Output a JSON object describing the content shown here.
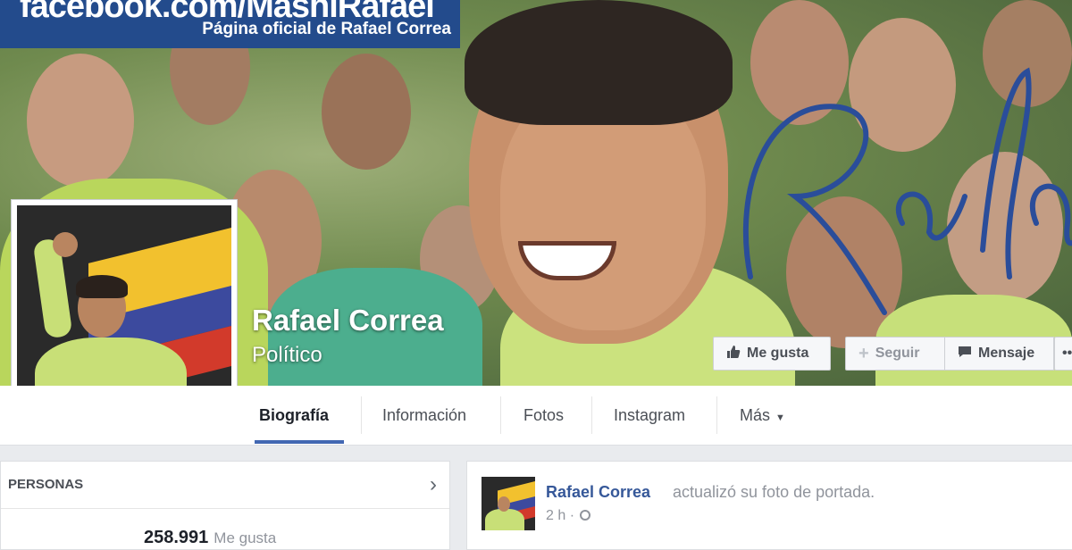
{
  "cover": {
    "banner_url": "facebook.com/MashiRafael",
    "banner_subtitle": "Página oficial de Rafael Correa"
  },
  "page": {
    "name": "Rafael Correa",
    "category": "Político"
  },
  "actions": {
    "like": "Me gusta",
    "follow": "Seguir",
    "message": "Mensaje"
  },
  "tabs": [
    {
      "label": "Biografía",
      "active": true
    },
    {
      "label": "Información"
    },
    {
      "label": "Fotos"
    },
    {
      "label": "Instagram"
    },
    {
      "label": "Más"
    }
  ],
  "people_box": {
    "title": "PERSONAS",
    "likes_count": "258.991",
    "likes_label": "Me gusta"
  },
  "post": {
    "author": "Rafael Correa",
    "action": "actualizó su foto de portada.",
    "time": "2 h",
    "separator": "·"
  },
  "colors": {
    "link_blue": "#365899",
    "tab_active": "#4267b2",
    "banner_blue": "#234b8c"
  }
}
